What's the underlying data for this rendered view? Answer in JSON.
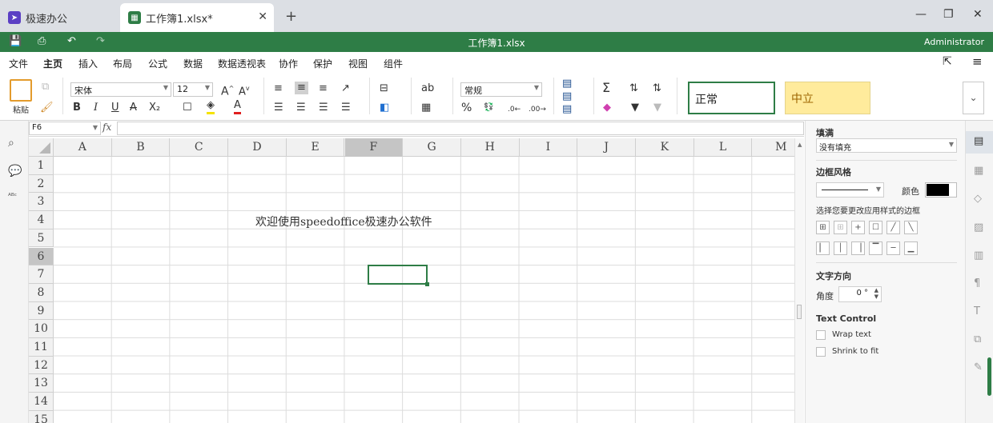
{
  "tabs": [
    {
      "label": "极速办公",
      "icon": "rocket-icon",
      "color": "#5b3fc4"
    },
    {
      "label": "工作簿1.xlsx*",
      "icon": "spreadsheet-icon",
      "color": "#2e7d46",
      "close": "✕"
    }
  ],
  "newtab": "+",
  "window": {
    "minimize": "—",
    "restore": "❐",
    "close": "✕"
  },
  "titlebar": {
    "title": "工作簿1.xlsx",
    "user": "Administrator",
    "color": "#2e7d46"
  },
  "menu": [
    "文件",
    "主页",
    "插入",
    "布局",
    "公式",
    "数据",
    "数据透视表",
    "协作",
    "保护",
    "视图",
    "组件"
  ],
  "ribbon": {
    "paste": "粘贴",
    "font": "宋体",
    "size": "12",
    "numfmt": "常规",
    "percent": "%",
    "styles": {
      "normal": "正常",
      "neutral": "中立"
    }
  },
  "formula": {
    "namebox": "F6",
    "fx": "fx",
    "value": ""
  },
  "grid": {
    "columns": [
      "A",
      "B",
      "C",
      "D",
      "E",
      "F",
      "G",
      "H",
      "I",
      "J",
      "K",
      "L",
      "M"
    ],
    "rows": [
      "1",
      "2",
      "3",
      "4",
      "5",
      "6",
      "7",
      "8",
      "9",
      "10",
      "11",
      "12",
      "13",
      "14",
      "15"
    ],
    "active_column": "F",
    "active_row": "6",
    "cell_D3": "欢迎使用speedoffice极速办公软件"
  },
  "panel": {
    "fill_label": "填满",
    "fill_value": "没有填充",
    "border_style_label": "边框风格",
    "color_label": "颜色",
    "border_hint": "选择您要更改应用样式的边框",
    "text_dir_label": "文字方向",
    "angle_label": "角度",
    "angle_value": "0 °",
    "text_control_label": "Text Control",
    "wrap": "Wrap text",
    "shrink": "Shrink to fit"
  }
}
